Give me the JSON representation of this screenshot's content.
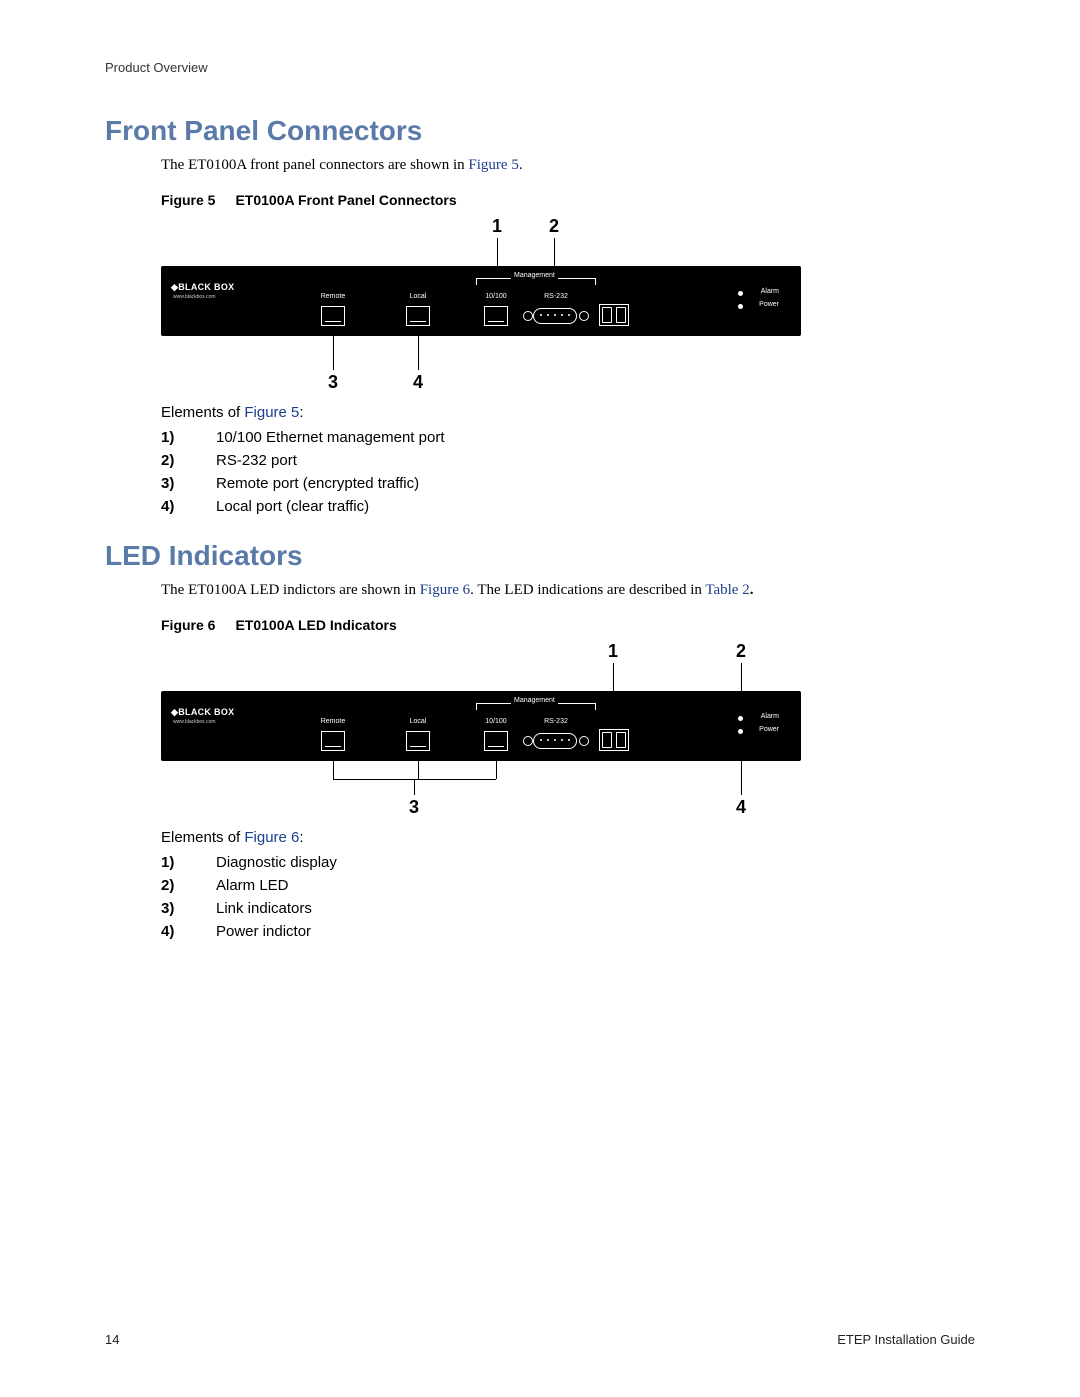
{
  "header": {
    "section": "Product Overview"
  },
  "section1": {
    "title": "Front Panel Connectors",
    "intro_pre": "The ET0100A front panel connectors are shown in ",
    "intro_link": "Figure 5",
    "intro_post": ".",
    "fig_label": "Figure 5",
    "fig_title": "ET0100A Front Panel Connectors",
    "callouts": {
      "c1": "1",
      "c2": "2",
      "c3": "3",
      "c4": "4"
    },
    "elements_pre": "Elements of ",
    "elements_link": "Figure 5",
    "elements_post": ":",
    "items": [
      {
        "num": "1)",
        "text": "10/100 Ethernet management port"
      },
      {
        "num": "2)",
        "text": "RS-232 port"
      },
      {
        "num": "3)",
        "text": "Remote port (encrypted traffic)"
      },
      {
        "num": "4)",
        "text": "Local port (clear traffic)"
      }
    ]
  },
  "section2": {
    "title": "LED Indicators",
    "intro_pre": "The ET0100A LED indictors are shown in ",
    "intro_link1": "Figure 6",
    "intro_mid": ". The LED indications are described in ",
    "intro_link2": "Table 2",
    "intro_post": ".",
    "fig_label": "Figure 6",
    "fig_title": "ET0100A LED Indicators",
    "callouts": {
      "c1": "1",
      "c2": "2",
      "c3": "3",
      "c4": "4"
    },
    "elements_pre": "Elements of ",
    "elements_link": "Figure 6",
    "elements_post": ":",
    "items": [
      {
        "num": "1)",
        "text": "Diagnostic display"
      },
      {
        "num": "2)",
        "text": "Alarm LED"
      },
      {
        "num": "3)",
        "text": "Link indicators"
      },
      {
        "num": "4)",
        "text": "Power indictor"
      }
    ]
  },
  "panel": {
    "logo": "◆BLACK BOX",
    "logo_url": "www.blackbox.com",
    "remote": "Remote",
    "local": "Local",
    "mgmt": "Management",
    "p10100": "10/100",
    "rs232": "RS-232",
    "alarm": "Alarm",
    "power": "Power"
  },
  "footer": {
    "page": "14",
    "guide": "ETEP Installation Guide"
  }
}
